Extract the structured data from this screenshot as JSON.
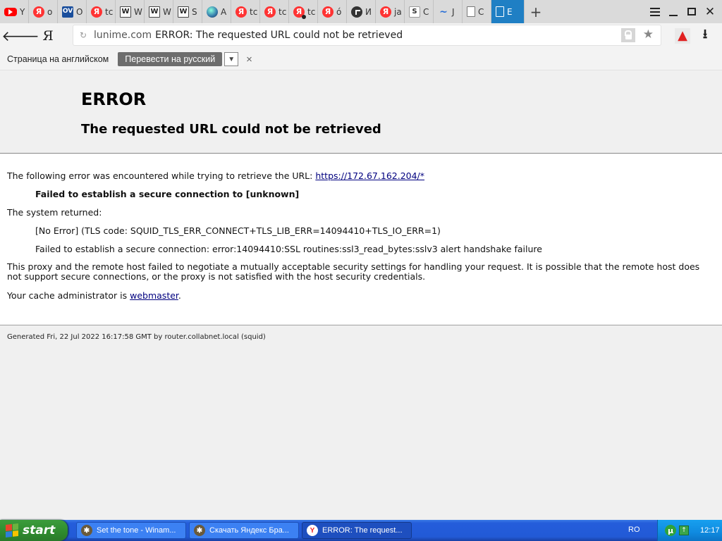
{
  "tabs": [
    {
      "icon": "youtube-icon",
      "label": "Y",
      "glyph": ""
    },
    {
      "icon": "yandex-icon",
      "label": "o",
      "glyph": "Я"
    },
    {
      "icon": "ov-icon",
      "label": "O",
      "glyph": "OV"
    },
    {
      "icon": "yandex-icon",
      "label": "tc",
      "glyph": "Я"
    },
    {
      "icon": "wikipedia-icon",
      "label": "W",
      "glyph": "W"
    },
    {
      "icon": "wikipedia-icon",
      "label": "W",
      "glyph": "W"
    },
    {
      "icon": "wikipedia-icon",
      "label": "S",
      "glyph": "W"
    },
    {
      "icon": "globe-icon",
      "label": "A",
      "glyph": ""
    },
    {
      "icon": "yandex-icon",
      "label": "tc",
      "glyph": "Я"
    },
    {
      "icon": "yandex-icon",
      "label": "tc",
      "glyph": "Я"
    },
    {
      "icon": "yandex-icon",
      "label": "tc",
      "glyph": "Я"
    },
    {
      "icon": "yandex-icon",
      "label": "ó",
      "glyph": "Я"
    },
    {
      "icon": "clock-icon",
      "label": "И",
      "glyph": ""
    },
    {
      "icon": "yandex-icon",
      "label": "ja",
      "glyph": "Я"
    },
    {
      "icon": "s-icon",
      "label": "C",
      "glyph": "S"
    },
    {
      "icon": "wave-icon",
      "label": "J",
      "glyph": "~"
    },
    {
      "icon": "page-icon",
      "label": "C",
      "glyph": ""
    },
    {
      "icon": "page-icon",
      "label": "E",
      "glyph": ""
    }
  ],
  "address": {
    "host": "lunime.com",
    "title": "ERROR: The requested URL could not be retrieved",
    "ya_glyph": "Я"
  },
  "translate": {
    "label": "Страница на английском",
    "button": "Перевести на русский",
    "close": "×"
  },
  "page": {
    "title": "ERROR",
    "subtitle": "The requested URL could not be retrieved",
    "intro": "The following error was encountered while trying to retrieve the URL: ",
    "url": "https://172.67.162.204/*",
    "failed": "Failed to establish a secure connection to [unknown]",
    "system_returned": "The system returned:",
    "tls_code": "[No Error] (TLS code: SQUID_TLS_ERR_CONNECT+TLS_LIB_ERR=14094410+TLS_IO_ERR=1)",
    "ssl_error": "Failed to establish a secure connection: error:14094410:SSL routines:ssl3_read_bytes:sslv3 alert handshake failure",
    "explanation": "This proxy and the remote host failed to negotiate a mutually acceptable security settings for handling your request. It is possible that the remote host does not support secure connections, or the proxy is not satisfied with the host security credentials.",
    "admin_prefix": "Your cache administrator is ",
    "admin_link": "webmaster",
    "admin_suffix": ".",
    "footer": "Generated Fri, 22 Jul 2022 16:17:58 GMT by router.collabnet.local (squid)"
  },
  "taskbar": {
    "start": "start",
    "tasks": [
      {
        "label": "Set the tone - Winam..."
      },
      {
        "label": "Скачать Яндекс Бра..."
      },
      {
        "label": "ERROR: The request..."
      }
    ],
    "lang": "RO",
    "clock": "12:17"
  },
  "colors": {
    "active_tab": "#1f7fc4",
    "link": "#00007f",
    "taskbar": "#245ddb",
    "start": "#2e8a2e"
  }
}
